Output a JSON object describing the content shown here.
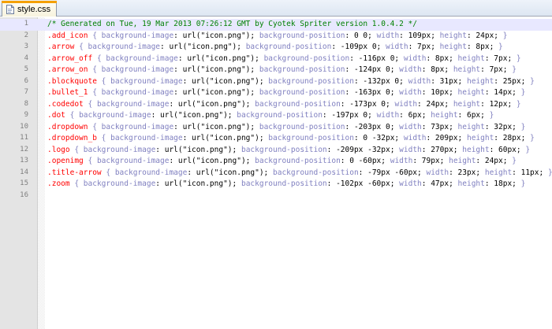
{
  "tab": {
    "label": "style.css",
    "icon": "file-icon",
    "accent_color": "#f4a000"
  },
  "editor": {
    "lines": [
      {
        "number": "1",
        "comment": "/* Generated on Tue, 19 Mar 2013 07:26:12 GMT by Cyotek Spriter version 1.0.4.2 */"
      },
      {
        "number": "2",
        "selector": ".add_icon",
        "rule": "{ background-image: url(\"icon.png\"); background-position: 0 0; width: 109px; height: 24px; }"
      },
      {
        "number": "3",
        "selector": ".arrow",
        "rule": "{ background-image: url(\"icon.png\"); background-position: -109px 0; width: 7px; height: 8px; }"
      },
      {
        "number": "4",
        "selector": ".arrow_off",
        "rule": "{ background-image: url(\"icon.png\"); background-position: -116px 0; width: 8px; height: 7px; }"
      },
      {
        "number": "5",
        "selector": ".arrow_on",
        "rule": "{ background-image: url(\"icon.png\"); background-position: -124px 0; width: 8px; height: 7px; }"
      },
      {
        "number": "6",
        "selector": ".blockquote",
        "rule": "{ background-image: url(\"icon.png\"); background-position: -132px 0; width: 31px; height: 25px; }"
      },
      {
        "number": "7",
        "selector": ".bullet_1",
        "rule": "{ background-image: url(\"icon.png\"); background-position: -163px 0; width: 10px; height: 14px; }"
      },
      {
        "number": "8",
        "selector": ".codedot",
        "rule": "{ background-image: url(\"icon.png\"); background-position: -173px 0; width: 24px; height: 12px; }"
      },
      {
        "number": "9",
        "selector": ".dot",
        "rule": "{ background-image: url(\"icon.png\"); background-position: -197px 0; width: 6px; height: 6px; }"
      },
      {
        "number": "10",
        "selector": ".dropdown",
        "rule": "{ background-image: url(\"icon.png\"); background-position: -203px 0; width: 73px; height: 32px; }"
      },
      {
        "number": "11",
        "selector": ".dropdown_b",
        "rule": "{ background-image: url(\"icon.png\"); background-position: 0 -32px; width: 209px; height: 28px; }"
      },
      {
        "number": "12",
        "selector": ".logo",
        "rule": "{ background-image: url(\"icon.png\"); background-position: -209px -32px; width: 270px; height: 60px; }"
      },
      {
        "number": "13",
        "selector": ".openimg",
        "rule": "{ background-image: url(\"icon.png\"); background-position: 0 -60px; width: 79px; height: 24px; }"
      },
      {
        "number": "14",
        "selector": ".title-arrow",
        "rule": "{ background-image: url(\"icon.png\"); background-position: -79px -60px; width: 23px; height: 11px; }"
      },
      {
        "number": "15",
        "selector": ".zoom",
        "rule": "{ background-image: url(\"icon.png\"); background-position: -102px -60px; width: 47px; height: 18px; }"
      },
      {
        "number": "16"
      }
    ],
    "current_line": 1
  }
}
